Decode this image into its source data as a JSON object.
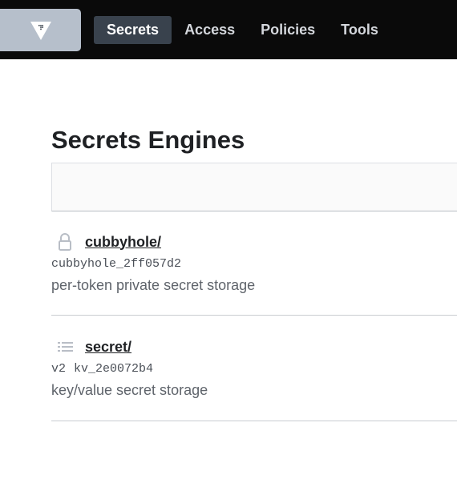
{
  "nav": {
    "logo_icon": "vault-logo-icon",
    "items": [
      {
        "label": "Secrets",
        "active": true
      },
      {
        "label": "Access",
        "active": false
      },
      {
        "label": "Policies",
        "active": false
      },
      {
        "label": "Tools",
        "active": false
      }
    ]
  },
  "main": {
    "title": "Secrets Engines",
    "engines": [
      {
        "icon": "lock-icon",
        "path": "cubbyhole/",
        "version": "",
        "accessor": "cubbyhole_2ff057d2",
        "description": "per-token private secret storage"
      },
      {
        "icon": "list-icon",
        "path": "secret/",
        "version": "v2",
        "accessor": "kv_2e0072b4",
        "description": "key/value secret storage"
      }
    ]
  },
  "colors": {
    "topbar": "#0a0a0a",
    "nav_active_bg": "#39424d",
    "logo_bg": "#b6bfcb"
  }
}
